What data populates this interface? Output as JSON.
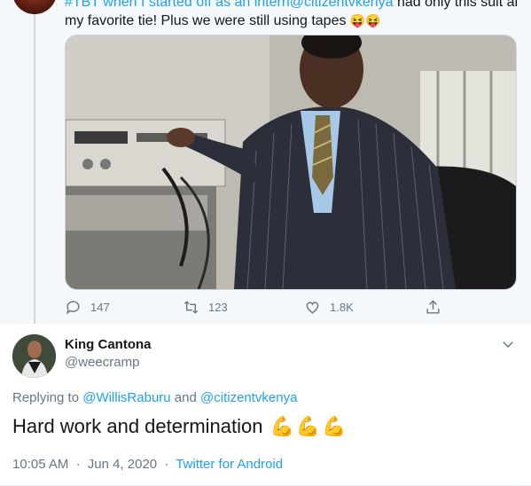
{
  "parent_tweet": {
    "text_line1_prefix": "#TBT when I started off as an intern",
    "text_line1_mention": "@citizentvkenya",
    "text_line1_suffix": " had only this suit and",
    "text_line2": "my favorite tie! Plus we were still using tapes",
    "text_line2_emojis": "😝😝",
    "actions": {
      "replies": "147",
      "retweets": "123",
      "likes": "1.8K"
    }
  },
  "reply_tweet": {
    "author_name": "King Cantona",
    "author_handle": "@weecramp",
    "replying_to_prefix": "Replying to ",
    "replying_to_user1": "@WillisRaburu",
    "replying_to_and": " and ",
    "replying_to_user2": "@citizentvkenya",
    "text": "Hard work and determination",
    "text_emojis": "💪💪💪",
    "time": "10:05 AM",
    "date": "Jun 4, 2020",
    "separator": "·",
    "source": "Twitter for Android"
  },
  "icons": {
    "reply": "speech-bubble",
    "retweet": "retweet-arrows",
    "like": "heart-outline",
    "share": "share-arrow",
    "more": "chevron-down"
  },
  "colors": {
    "link": "#1da1f2",
    "secondary_text": "#657786",
    "primary_text": "#14171a",
    "parent_bg": "#f5f8fa"
  }
}
